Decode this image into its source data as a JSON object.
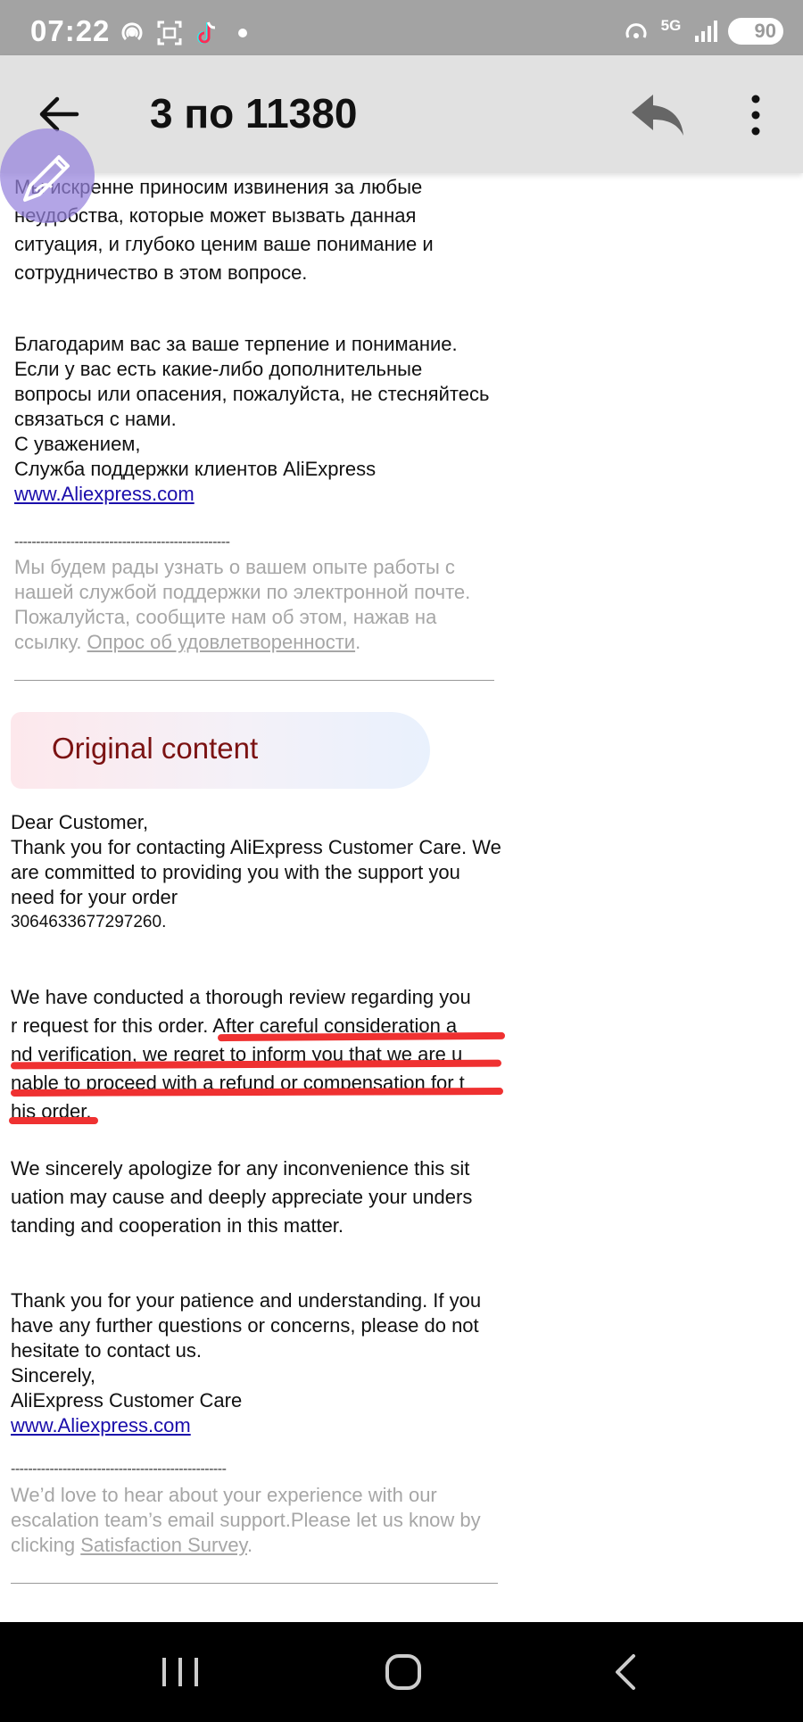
{
  "status_bar": {
    "time": "07:22",
    "battery": "90",
    "network": "5G",
    "icons": [
      "hotspot-icon",
      "screenshot-icon",
      "tiktok-icon",
      "dot-icon",
      "wifi-icon",
      "signal-icon",
      "battery-icon"
    ]
  },
  "header": {
    "title": "3 по 11380",
    "icons": [
      "back-arrow-icon",
      "reply-icon",
      "more-vertical-icon"
    ]
  },
  "russian": {
    "para1": "Мы искренне приносим извинения за любые неудобства, которые может вызвать данная ситуация, и глубоко ценим ваше понимание и сотрудничество в этом вопросе.",
    "para2_lines": [
      "Благодарим вас за ваше терпение и понимание.",
      "Если у вас есть какие-либо дополнительные вопросы или опасения, пожалуйста, не стесняйтесь связаться с нами.",
      "С уважением,",
      "Служба поддержки клиентов AliExpress"
    ],
    "link": "www.Aliexpress.com",
    "dashes": "--------------------------------------------------",
    "survey_text": "Мы будем рады узнать о вашем опыте работы с нашей службой поддержки по электронной почте. Пожалуйста, сообщите нам об этом, нажав на ссылку. ",
    "survey_link": "Опрос об удовлетворенности",
    "survey_end": "."
  },
  "original": {
    "banner_title": "Original content",
    "greeting": "Dear Customer,",
    "intro": "Thank you for contacting AliExpress Customer Care. We are committed to providing you with the support you need for your order",
    "order_number": "3064633677297260.",
    "review_line1": "We have conducted a thorough review regarding you",
    "review_line2a": "r request for this order.",
    "review_line2b": " After careful consideration a",
    "review_line3": "nd verification, we regret to inform you that we are u",
    "review_line4": "nable to proceed with a refund or compensation for t",
    "review_line5": "his order.",
    "apology_lines": [
      "We sincerely apologize for any inconvenience this sit",
      "uation may cause and deeply appreciate your unders",
      "tanding and cooperation in this matter."
    ],
    "thanks": "Thank you for your patience and understanding. If you have any further questions or concerns, please do not hesitate to contact us.",
    "sincerely": "Sincerely,",
    "signature": "AliExpress Customer Care",
    "link": "www.Aliexpress.com",
    "dashes": "--------------------------------------------------",
    "survey_text": "We’d love to hear about your experience with our escalation team’s email support.Please let us know by clicking ",
    "survey_link": "Satisfaction Survey",
    "survey_end": "."
  },
  "nav_bar": {
    "icons": [
      "recents-icon",
      "home-icon",
      "back-icon"
    ]
  },
  "colors": {
    "status_bar": "#a3a3a3",
    "app_bar": "#e1e1e1",
    "link": "#1a0dab",
    "muted": "#a6a6a6",
    "annotation": "#ef3131",
    "banner_text": "#7b1212"
  }
}
